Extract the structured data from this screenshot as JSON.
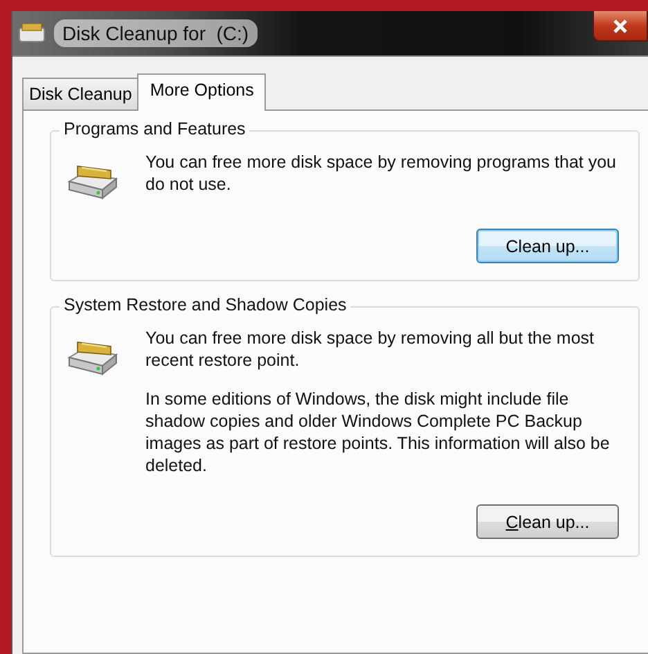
{
  "window": {
    "title": "Disk Cleanup for  (C:)"
  },
  "tabs": [
    {
      "label": "Disk Cleanup",
      "selected": false
    },
    {
      "label": "More Options",
      "selected": true
    }
  ],
  "groups": [
    {
      "title": "Programs and Features",
      "paragraphs": [
        "You can free more disk space by removing programs that you do not use."
      ],
      "button": {
        "label": "Clean up...",
        "focused": true,
        "underline_first": false
      }
    },
    {
      "title": "System Restore and Shadow Copies",
      "paragraphs": [
        "You can free more disk space by removing all but the most recent restore point.",
        "In some editions of Windows, the disk might include file shadow copies and older Windows Complete PC Backup images as part of restore points. This information will also be deleted."
      ],
      "button": {
        "label": "Clean up...",
        "focused": false,
        "underline_first": true
      }
    }
  ]
}
